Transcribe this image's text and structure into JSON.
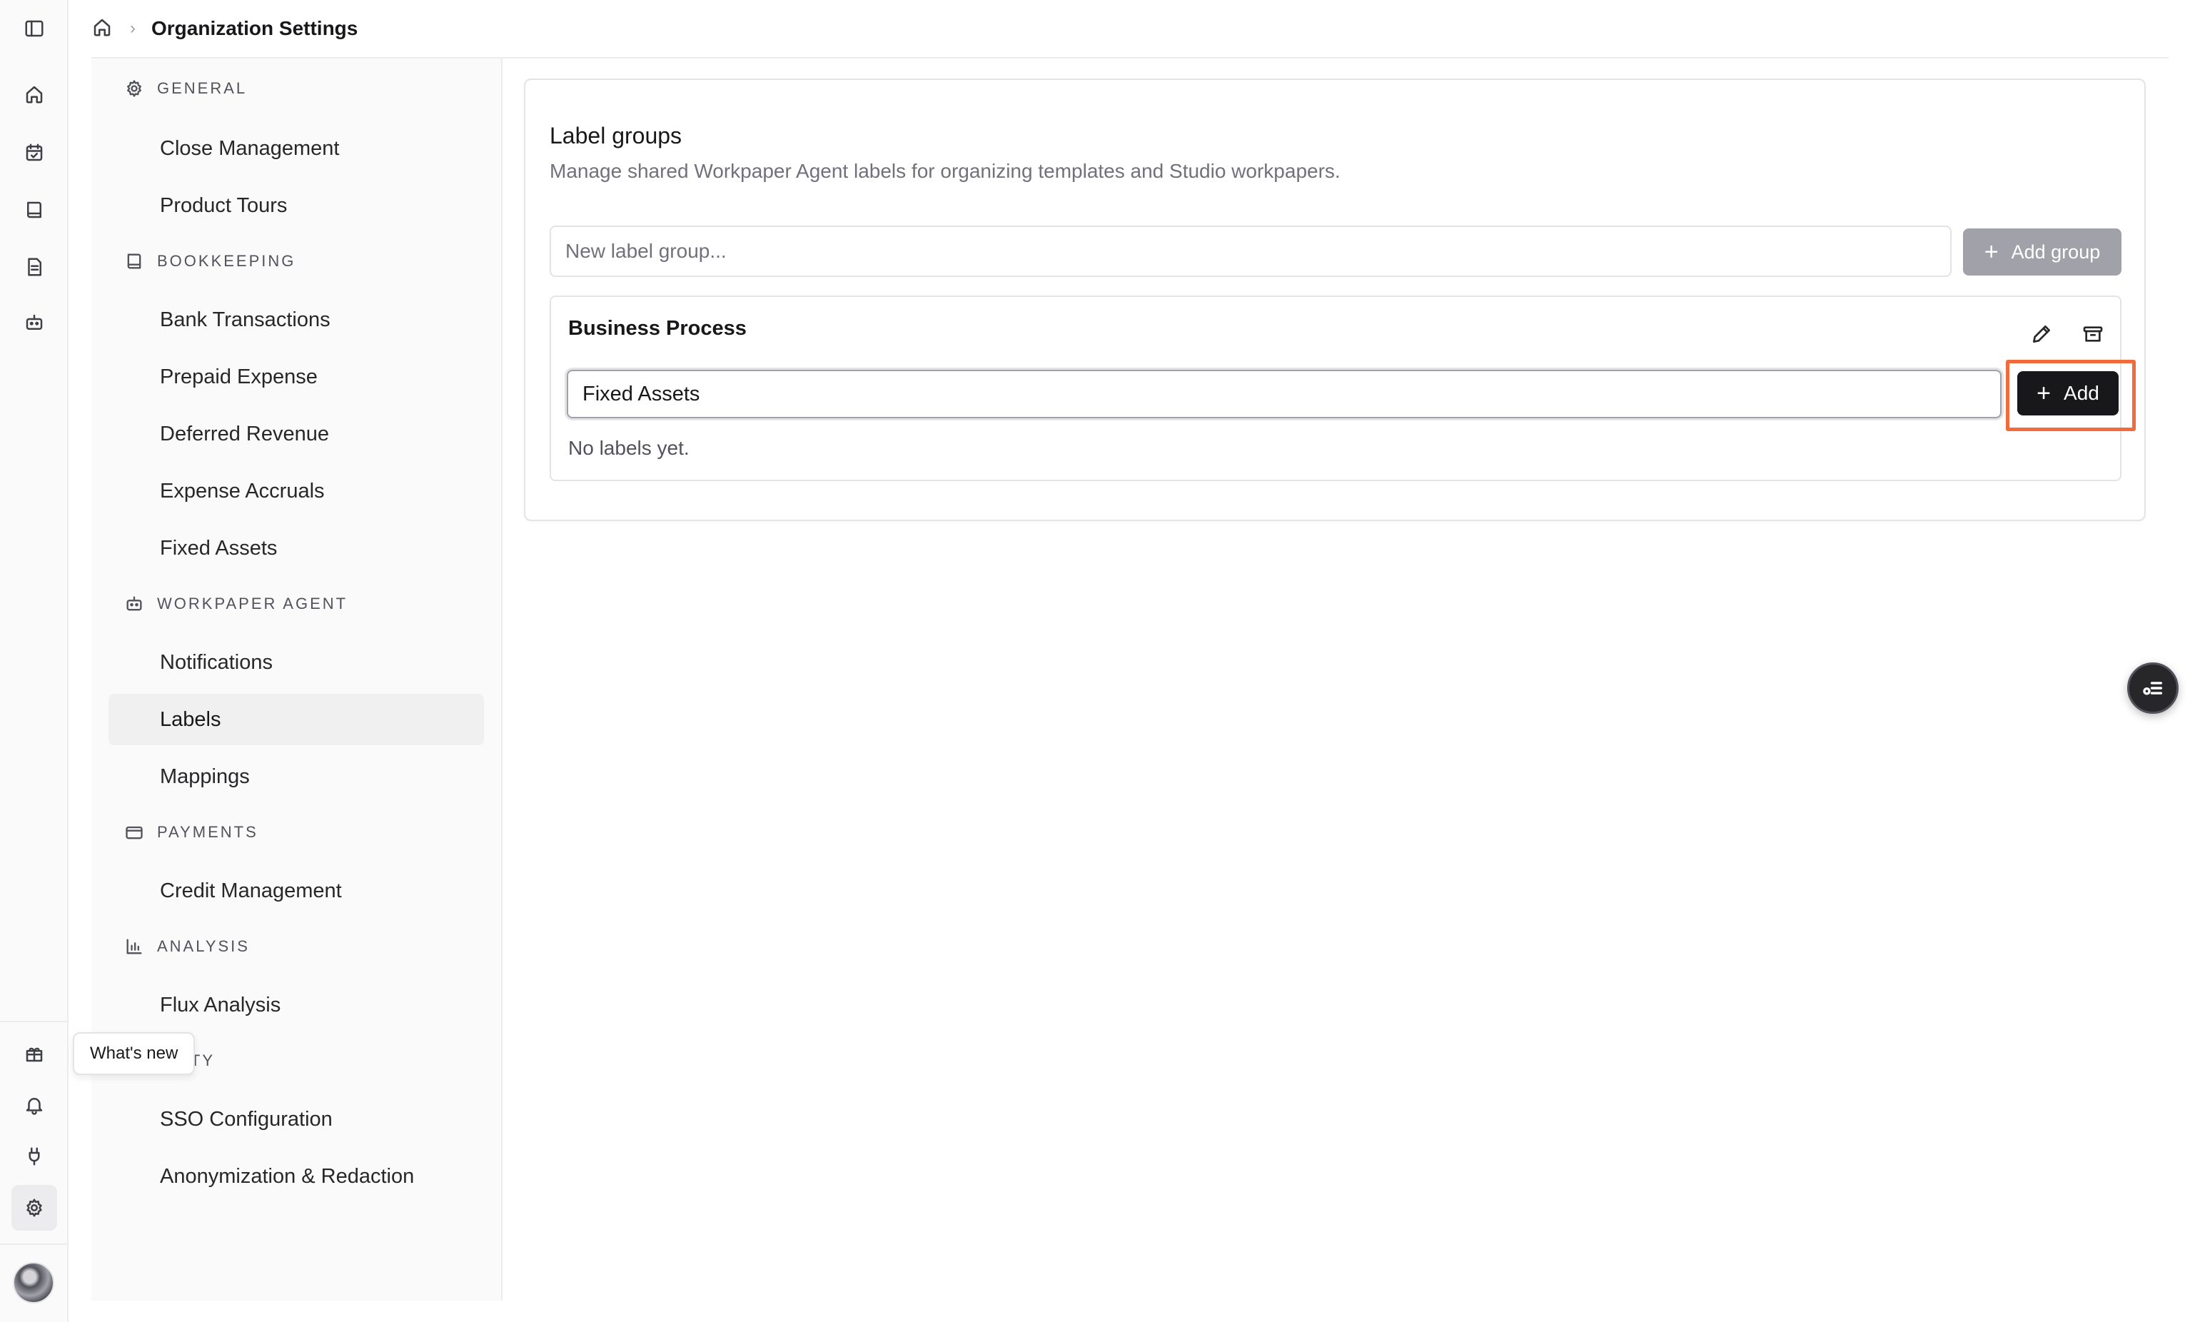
{
  "breadcrumb": {
    "current": "Organization Settings"
  },
  "rail": {
    "top_icons": [
      "sidebar-toggle-icon",
      "home-icon",
      "calendar-check-icon",
      "book-icon",
      "document-icon",
      "bot-icon"
    ],
    "bottom_icons": [
      "gift-icon",
      "bell-icon",
      "plug-icon",
      "gear-icon"
    ],
    "tooltip": "What's new"
  },
  "nav": {
    "sections": [
      {
        "title": "GENERAL",
        "icon": "gear-icon",
        "items": [
          "Close Management",
          "Product Tours"
        ]
      },
      {
        "title": "BOOKKEEPING",
        "icon": "book-icon",
        "items": [
          "Bank Transactions",
          "Prepaid Expense",
          "Deferred Revenue",
          "Expense Accruals",
          "Fixed Assets"
        ]
      },
      {
        "title": "WORKPAPER AGENT",
        "icon": "bot-icon",
        "items": [
          "Notifications",
          "Labels",
          "Mappings"
        ]
      },
      {
        "title": "PAYMENTS",
        "icon": "credit-card-icon",
        "items": [
          "Credit Management"
        ]
      },
      {
        "title": "ANALYSIS",
        "icon": "bar-chart-icon",
        "items": [
          "Flux Analysis"
        ]
      },
      {
        "title": "URITY",
        "icon": "shield-icon",
        "items": [
          "SSO Configuration",
          "Anonymization & Redaction"
        ]
      }
    ],
    "active_item": "Labels"
  },
  "label_groups": {
    "title": "Label groups",
    "subtitle": "Manage shared Workpaper Agent labels for organizing templates and Studio workpapers.",
    "new_group_placeholder": "New label group...",
    "add_group_label": "Add group",
    "groups": [
      {
        "name": "Business Process",
        "label_input_value": "Fixed Assets",
        "add_label": "Add",
        "empty_text": "No labels yet."
      }
    ]
  },
  "colors": {
    "accent_highlight": "#f26b3a",
    "primary_button": "#18181b",
    "disabled_button": "#a1a1aa"
  }
}
